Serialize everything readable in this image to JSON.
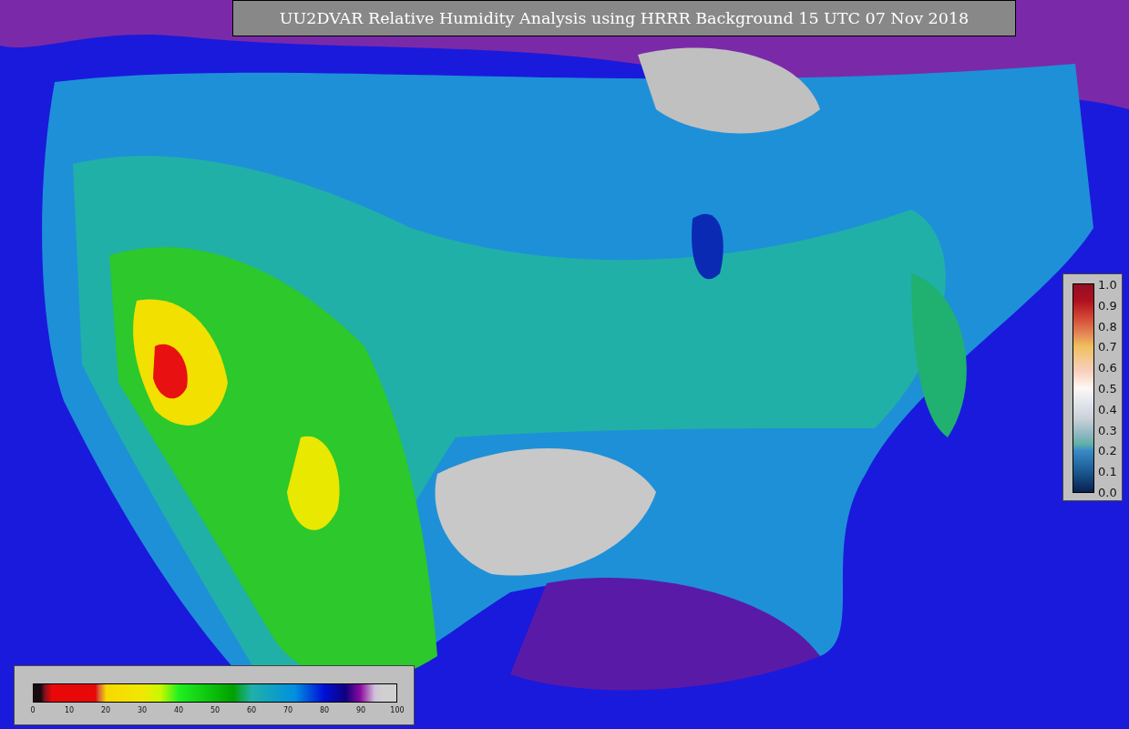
{
  "title": "UU2DVAR Relative Humidity Analysis using HRRR Background 15 UTC 07 Nov 2018",
  "humidity_colorbar": {
    "ticks": [
      "0",
      "10",
      "20",
      "30",
      "40",
      "50",
      "60",
      "70",
      "80",
      "90",
      "100"
    ]
  },
  "observation_colorbar": {
    "ticks": [
      "1.0",
      "0.9",
      "0.8",
      "0.7",
      "0.6",
      "0.5",
      "0.4",
      "0.3",
      "0.2",
      "0.1",
      "0.0"
    ]
  }
}
